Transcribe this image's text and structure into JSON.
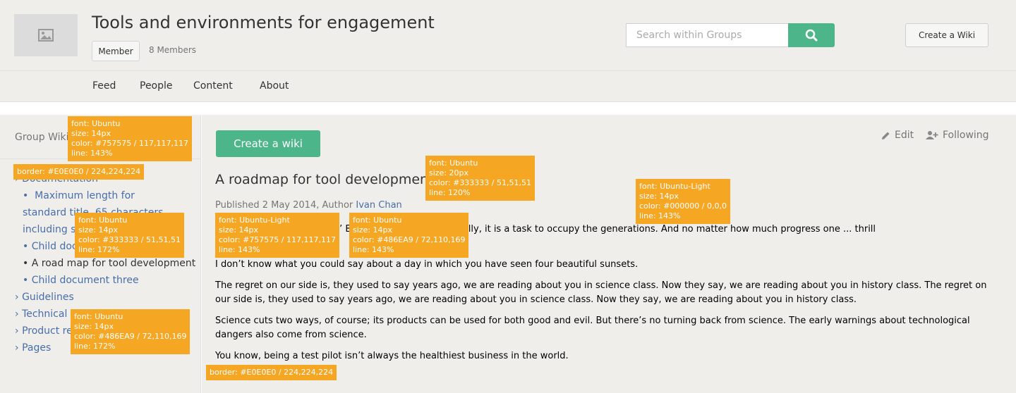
{
  "header": {
    "title": "Tools and environments for engagement",
    "member_label": "Member",
    "member_count": "8 Members",
    "search_placeholder": "Search within Groups",
    "create_wiki_label": "Create a Wiki",
    "nav": [
      "Feed",
      "People",
      "Content",
      "About"
    ]
  },
  "sidebar": {
    "title": "Group Wiki",
    "items": [
      {
        "prefix": "›",
        "label": "Documentation"
      },
      {
        "prefix": "•",
        "label": "Maximum length for standard title, 65 characters including spaces"
      },
      {
        "prefix": "•",
        "label": "Child document"
      },
      {
        "prefix": "•",
        "label": "A road map for tool development"
      },
      {
        "prefix": "•",
        "label": "Child document three"
      },
      {
        "prefix": "›",
        "label": "Guidelines"
      },
      {
        "prefix": "›",
        "label": "Technical i"
      },
      {
        "prefix": "›",
        "label": "Product re"
      },
      {
        "prefix": "›",
        "label": "Pages"
      }
    ]
  },
  "main": {
    "create_button": "Create a wiki",
    "edit_label": "Edit",
    "following_label": "Following",
    "title": "A roadmap for tool development",
    "byline_prefix": "Published 2 May 2014, Author",
    "author": "Ivan Chan",
    "paragraphs": [
      "Space is full of fine... stars.’ Both figuratively and literally, it is a task to occupy the generations. And no matter how much progress one ... thrill",
      "I don’t know what you could say about a day in which you have seen four beautiful sunsets.",
      "The regret on our side is, they used to say years ago, we are reading about you in science class. Now they say, we are reading about you in history class. The regret on our side is, they used to say years ago, we are reading about you in science class. Now they say, we are reading about you in history class.",
      "Science cuts two ways, of course; its products can be used for both good and evil. But there’s no turning back from science. The early warnings about technological dangers also come from science.",
      "You know, being a test pilot isn’t always the healthiest business in the world."
    ]
  },
  "annotations": {
    "sidebar_title": [
      "font: Ubuntu",
      "size: 14px",
      "color: #757575 / 117,117,117",
      "line: 143%"
    ],
    "sidebar_border": "border: #E0E0E0 / 224,224,224",
    "sidebar_current": [
      "font: Ubuntu",
      "size: 14px",
      "color: #333333 / 51,51,51",
      "line: 172%"
    ],
    "sidebar_link": [
      "font: Ubuntu",
      "size: 14px",
      "color: #486EA9 / 72,110,169",
      "line: 172%"
    ],
    "title": [
      "font: Ubuntu",
      "size: 20px",
      "color: #333333 / 51,51,51",
      "line: 120%"
    ],
    "body": [
      "font: Ubuntu-Light",
      "size: 14px",
      "color: #000000 / 0,0,0",
      "line: 143%"
    ],
    "byline": [
      "font: Ubuntu-Light",
      "size: 14px",
      "color: #757575 / 117,117,117",
      "line: 143%"
    ],
    "author": [
      "font: Ubuntu",
      "size: 14px",
      "color: #486EA9 / 72,110,169",
      "line: 143%"
    ],
    "main_border": "border: #E0E0E0 / 224,224,224"
  },
  "colors": {
    "accent": "#4cb58a",
    "link": "#486ea9",
    "annotation": "#f5a623"
  }
}
